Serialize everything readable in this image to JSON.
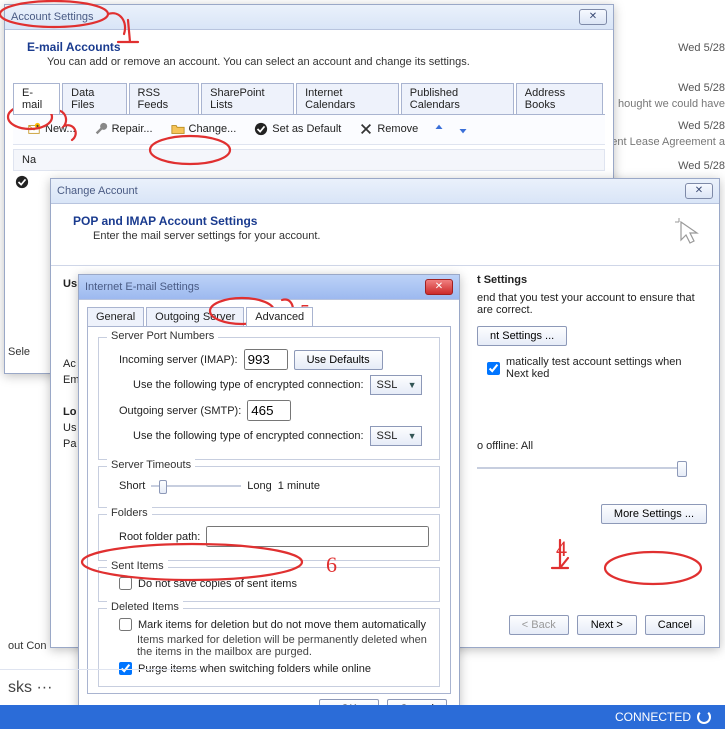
{
  "bg": {
    "d1": "Wed 5/28",
    "d2": "Wed 5/28",
    "t2": "hought we could have",
    "d3": "Wed 5/28",
    "t3": "rent Lease Agreement a",
    "d4": "Wed 5/28"
  },
  "acct": {
    "title": "Account Settings",
    "head": "E-mail Accounts",
    "sub": "You can add or remove an account. You can select an account and change its settings.",
    "tabs": [
      "E-mail",
      "Data Files",
      "RSS Feeds",
      "SharePoint Lists",
      "Internet Calendars",
      "Published Calendars",
      "Address Books"
    ],
    "tool": {
      "new": "New...",
      "repair": "Repair...",
      "change": "Change...",
      "set": "Set as Default",
      "remove": "Remove"
    },
    "col": "Na"
  },
  "change": {
    "title": "Change Account",
    "head": "POP and IMAP Account Settings",
    "sub": "Enter the mail server settings for your account.",
    "left": {
      "us": "Us",
      "lo": "Lo",
      "ac": "Ac",
      "em": "Em",
      "pa": "Pa",
      "us2": "Us",
      "sel": "Sele",
      "outcon": "out Con"
    },
    "tests_head": "t Settings",
    "tests_line": "end that you test your account to ensure that are correct.",
    "testbtn": "nt Settings ...",
    "autotest": "matically test account settings when Next ked",
    "offline": "o offline:    All",
    "back": "< Back",
    "next": "Next >",
    "cancel": "Cancel",
    "more": "More Settings ..."
  },
  "inet": {
    "title": "Internet E-mail Settings",
    "tabs": [
      "General",
      "Outgoing Server",
      "Advanced"
    ],
    "group1": "Server Port Numbers",
    "in_lbl": "Incoming server (IMAP):",
    "in_val": "993",
    "usedef": "Use Defaults",
    "enc_lbl": "Use the following type of encrypted connection:",
    "enc_val": "SSL",
    "out_lbl": "Outgoing server (SMTP):",
    "out_val": "465",
    "group2": "Server Timeouts",
    "short": "Short",
    "long": "Long",
    "dur": "1 minute",
    "group3": "Folders",
    "root_lbl": "Root folder path:",
    "root_val": "",
    "group4": "Sent Items",
    "sent_chk": "Do not save copies of sent items",
    "group5": "Deleted Items",
    "del_chk": "Mark items for deletion but do not move them automatically",
    "del_note": "Items marked for deletion will be permanently deleted when the items in the mailbox are purged.",
    "purge_chk": "Purge items when switching folders while online",
    "ok": "OK",
    "cancel": "Cancel"
  },
  "status": {
    "conn": "CONNECTED"
  },
  "tasks": "sks  ···"
}
